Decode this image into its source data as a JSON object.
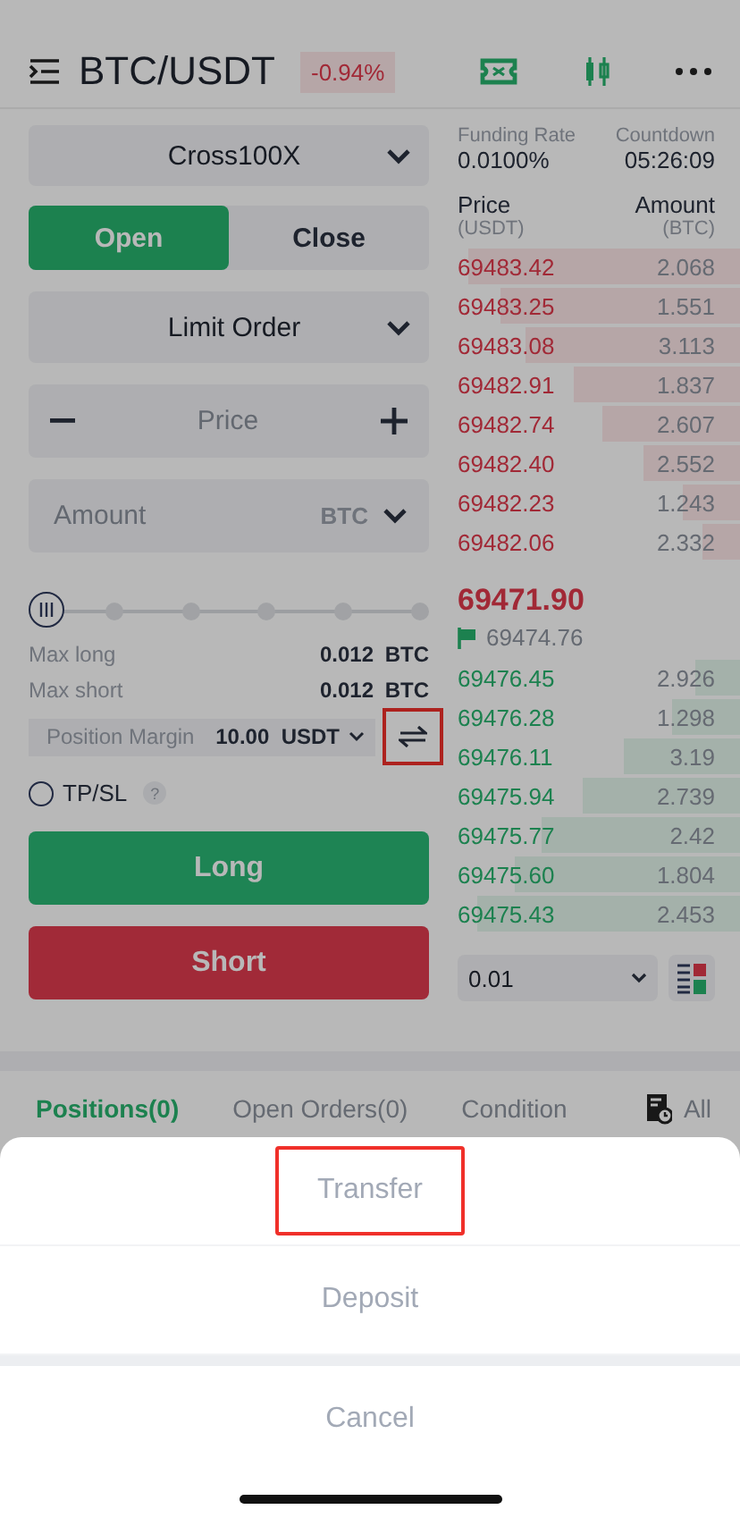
{
  "header": {
    "pair": "BTC/USDT",
    "change": "-0.94%"
  },
  "margin_mode": {
    "value": "Cross100X"
  },
  "side_tabs": [
    {
      "label": "Open",
      "selected": true
    },
    {
      "label": "Close",
      "selected": false
    }
  ],
  "order_type": {
    "value": "Limit Order"
  },
  "price_field": {
    "placeholder": "Price"
  },
  "amount_field": {
    "placeholder": "Amount",
    "unit": "BTC"
  },
  "leverage_slider": {
    "level": 0
  },
  "max_long": {
    "label": "Max long",
    "value": "0.012",
    "unit": "BTC"
  },
  "max_short": {
    "label": "Max short",
    "value": "0.012",
    "unit": "BTC"
  },
  "position_margin": {
    "label": "Position Margin",
    "value": "10.00",
    "unit": "USDT"
  },
  "transfer_button": {
    "highlighted": true
  },
  "tpsl": {
    "label": "TP/SL",
    "checked": false,
    "help": "?"
  },
  "actions": [
    {
      "label": "Long",
      "kind": "long"
    },
    {
      "label": "Short",
      "kind": "short"
    }
  ],
  "funding": {
    "label": "Funding Rate",
    "value": "0.0100%"
  },
  "countdown": {
    "label": "Countdown",
    "value": "05:26:09"
  },
  "book": {
    "price_label": "Price",
    "price_unit": "(USDT)",
    "amount_label": "Amount",
    "amount_unit": "(BTC)",
    "asks": [
      {
        "price": "69483.42",
        "amount": "2.068"
      },
      {
        "price": "69483.25",
        "amount": "1.551"
      },
      {
        "price": "69483.08",
        "amount": "3.113"
      },
      {
        "price": "69482.91",
        "amount": "1.837"
      },
      {
        "price": "69482.74",
        "amount": "2.607"
      },
      {
        "price": "69482.40",
        "amount": "2.552"
      },
      {
        "price": "69482.23",
        "amount": "1.243"
      },
      {
        "price": "69482.06",
        "amount": "2.332"
      }
    ],
    "last_price": "69471.90",
    "mark_price": "69474.76",
    "bids": [
      {
        "price": "69476.45",
        "amount": "2.926"
      },
      {
        "price": "69476.28",
        "amount": "1.298"
      },
      {
        "price": "69476.11",
        "amount": "3.19"
      },
      {
        "price": "69475.94",
        "amount": "2.739"
      },
      {
        "price": "69475.77",
        "amount": "2.42"
      },
      {
        "price": "69475.60",
        "amount": "1.804"
      },
      {
        "price": "69475.43",
        "amount": "2.453"
      }
    ],
    "precision": "0.01"
  },
  "bottom_tabs": [
    {
      "label": "Positions(0)",
      "selected": true
    },
    {
      "label": "Open Orders(0)",
      "selected": false
    },
    {
      "label": "Condition",
      "selected": false
    }
  ],
  "filter": {
    "label": "All"
  },
  "sheet": {
    "options": [
      {
        "label": "Transfer",
        "highlighted": true
      },
      {
        "label": "Deposit",
        "highlighted": false
      }
    ],
    "cancel": "Cancel"
  }
}
